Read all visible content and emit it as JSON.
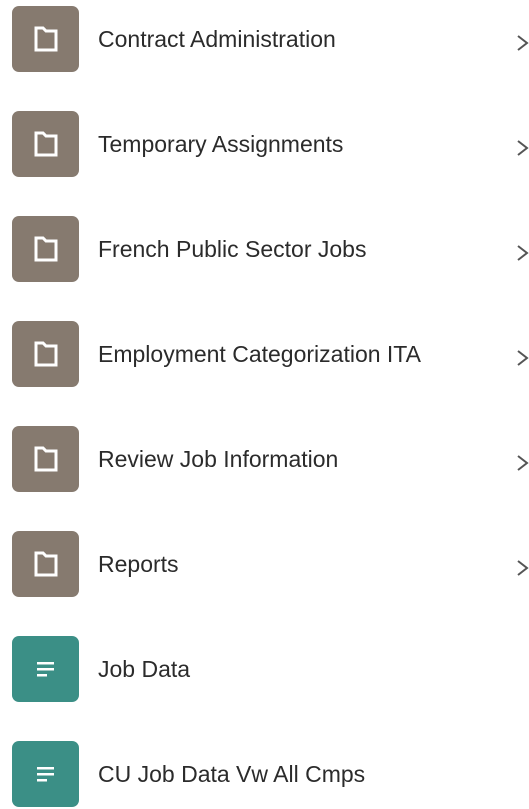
{
  "menu": {
    "items": [
      {
        "label": "Contract Administration",
        "kind": "folder",
        "has_children": true,
        "icon": "folder-icon"
      },
      {
        "label": "Temporary Assignments",
        "kind": "folder",
        "has_children": true,
        "icon": "folder-icon"
      },
      {
        "label": "French Public Sector Jobs",
        "kind": "folder",
        "has_children": true,
        "icon": "folder-icon"
      },
      {
        "label": "Employment Categorization ITA",
        "kind": "folder",
        "has_children": true,
        "icon": "folder-icon"
      },
      {
        "label": "Review Job Information",
        "kind": "folder",
        "has_children": true,
        "icon": "folder-icon"
      },
      {
        "label": "Reports",
        "kind": "folder",
        "has_children": true,
        "icon": "folder-icon"
      },
      {
        "label": "Job Data",
        "kind": "component",
        "has_children": false,
        "icon": "page-lines-icon"
      },
      {
        "label": "CU Job Data Vw All Cmps",
        "kind": "component",
        "has_children": false,
        "icon": "page-lines-icon"
      }
    ]
  },
  "colors": {
    "folder_tile": "#867a6f",
    "component_tile": "#3b8f86",
    "label_text": "#2b2b2b",
    "chevron": "#555555"
  }
}
